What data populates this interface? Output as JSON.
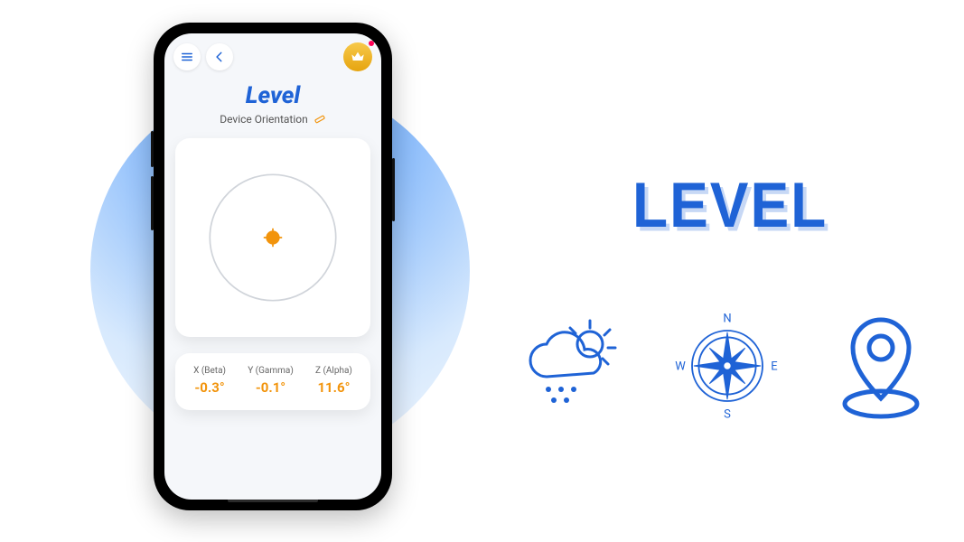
{
  "app": {
    "title": "Level",
    "subtitle": "Device Orientation"
  },
  "readings": {
    "x": {
      "label": "X (Beta)",
      "value": "-0.3°"
    },
    "y": {
      "label": "Y (Gamma)",
      "value": "-0.1°"
    },
    "z": {
      "label": "Z (Alpha)",
      "value": "11.6°"
    }
  },
  "marketing": {
    "headline": "LEVEL"
  },
  "compass": {
    "n": "N",
    "s": "S",
    "e": "E",
    "w": "W"
  }
}
